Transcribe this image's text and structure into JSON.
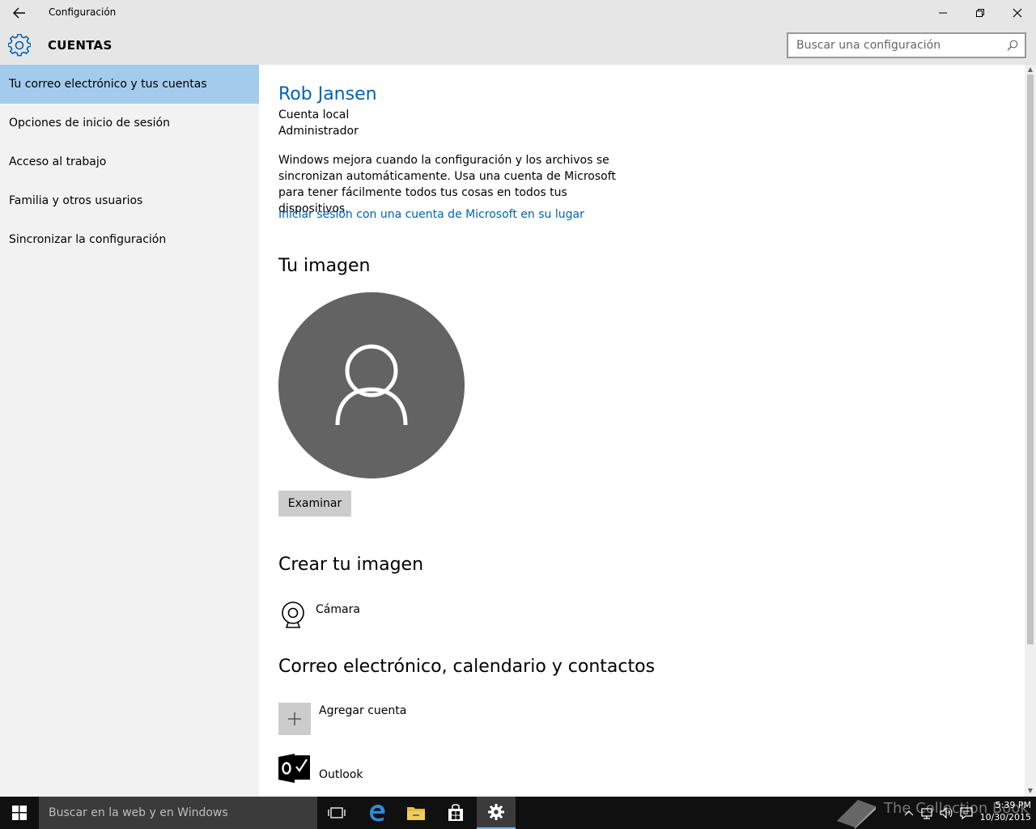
{
  "window": {
    "title": "Configuración"
  },
  "header": {
    "section_title": "CUENTAS",
    "search_placeholder": "Buscar una configuración"
  },
  "sidebar": {
    "items": [
      {
        "label": "Tu correo electrónico y tus cuentas",
        "selected": true
      },
      {
        "label": "Opciones de inicio de sesión",
        "selected": false
      },
      {
        "label": "Acceso al trabajo",
        "selected": false
      },
      {
        "label": "Familia y otros usuarios",
        "selected": false
      },
      {
        "label": "Sincronizar la configuración",
        "selected": false
      }
    ]
  },
  "account": {
    "name": "Rob Jansen",
    "type": "Cuenta local",
    "role": "Administrador",
    "sync_description": "Windows mejora cuando la configuración y los archivos se sincronizan automáticamente. Usa una cuenta de Microsoft para tener fácilmente todos tus cosas en todos tus dispositivos.",
    "ms_link": "Iniciar sesión con una cuenta de Microsoft en su lugar"
  },
  "picture": {
    "heading": "Tu imagen",
    "browse_label": "Examinar"
  },
  "create_picture": {
    "heading": "Crear tu imagen",
    "camera_label": "Cámara"
  },
  "email_accounts": {
    "heading": "Correo electrónico, calendario y contactos",
    "add_label": "Agregar cuenta",
    "outlook_label": "Outlook"
  },
  "taskbar": {
    "search_placeholder": "Buscar en la web y en Windows",
    "watermark": "The Collection Book",
    "time": "5:39 PM",
    "date": "10/30/2015"
  },
  "colors": {
    "accent": "#0063b1",
    "selected_nav": "#a3cbec",
    "avatar_bg": "#636363",
    "taskbar": "#101010"
  }
}
